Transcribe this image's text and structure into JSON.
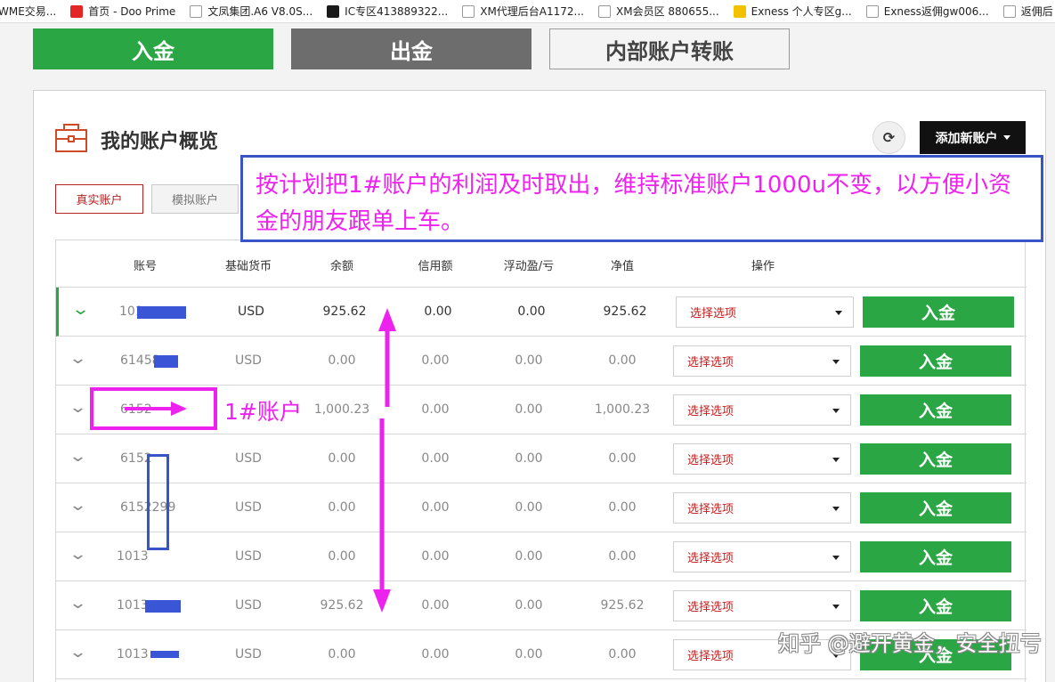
{
  "bookmarks": [
    {
      "label": "WME交易...",
      "icon": "page-icon",
      "color": "#ffffff"
    },
    {
      "label": "首页 - Doo Prime",
      "icon": "doo-prime-icon",
      "color": "#e32626"
    },
    {
      "label": "文凤集团.A6 V8.0S...",
      "icon": "a6-icon",
      "color": "#ffffff"
    },
    {
      "label": "IC专区413889322...",
      "icon": "ic-icon",
      "color": "#1a1a1a"
    },
    {
      "label": "XM代理后台A1172...",
      "icon": "xm-icon",
      "color": "#ffffff"
    },
    {
      "label": "XM会员区 880655...",
      "icon": "xm-icon",
      "color": "#ffffff"
    },
    {
      "label": "Exness 个人专区g...",
      "icon": "exness-icon",
      "color": "#f2c200"
    },
    {
      "label": "Exness返佣gw006...",
      "icon": "globe-icon",
      "color": "#ffffff"
    },
    {
      "label": "返佣后",
      "icon": "globe-icon",
      "color": "#ffffff"
    }
  ],
  "tabs": {
    "deposit": "入金",
    "withdraw": "出金",
    "transfer": "内部账户转账"
  },
  "panel": {
    "title": "我的账户概览",
    "add_account": "添加新账户",
    "real_tab": "真实账户",
    "demo_tab": "模拟账户"
  },
  "table": {
    "headers": [
      "账号",
      "基础货币",
      "余额",
      "信用额",
      "浮动盈/亏",
      "净值",
      "操作"
    ],
    "rows": [
      {
        "account": "101",
        "currency": "USD",
        "balance": "925.62",
        "credit": "0.00",
        "pl": "0.00",
        "equity": "925.62",
        "select": "选择选项",
        "action": "入金"
      },
      {
        "account": "61458",
        "currency": "USD",
        "balance": "0.00",
        "credit": "0.00",
        "pl": "0.00",
        "equity": "0.00",
        "select": "选择选项",
        "action": "入金"
      },
      {
        "account": "6152",
        "currency": "",
        "balance": "1,000.23",
        "credit": "0.00",
        "pl": "0.00",
        "equity": "1,000.23",
        "select": "选择选项",
        "action": "入金"
      },
      {
        "account": "6152",
        "currency": "USD",
        "balance": "0.00",
        "credit": "0.00",
        "pl": "0.00",
        "equity": "0.00",
        "select": "选择选项",
        "action": "入金"
      },
      {
        "account": "6152299",
        "currency": "USD",
        "balance": "0.00",
        "credit": "0.00",
        "pl": "0.00",
        "equity": "0.00",
        "select": "选择选项",
        "action": "入金"
      },
      {
        "account": "1013",
        "currency": "USD",
        "balance": "0.00",
        "credit": "0.00",
        "pl": "0.00",
        "equity": "0.00",
        "select": "选择选项",
        "action": "入金"
      },
      {
        "account": "1013",
        "currency": "USD",
        "balance": "925.62",
        "credit": "0.00",
        "pl": "0.00",
        "equity": "925.62",
        "select": "选择选项",
        "action": "入金"
      },
      {
        "account": "1013",
        "currency": "USD",
        "balance": "0.00",
        "credit": "0.00",
        "pl": "0.00",
        "equity": "0.00",
        "select": "选择选项",
        "action": "入金"
      }
    ]
  },
  "annotations": {
    "note": "按计划把1#账户的利润及时取出，维持标准账户1000u不变，以方便小资金的朋友跟单上车。",
    "account_label": "1#账户",
    "watermark": "知乎 @避开黄金，安全扭亏"
  },
  "colors": {
    "green": "#2aa744",
    "grey_tab": "#6d6d6d",
    "annotation_magenta": "#ee22ee",
    "annotation_blue": "#3954c6",
    "select_text": "#c41c1c"
  }
}
